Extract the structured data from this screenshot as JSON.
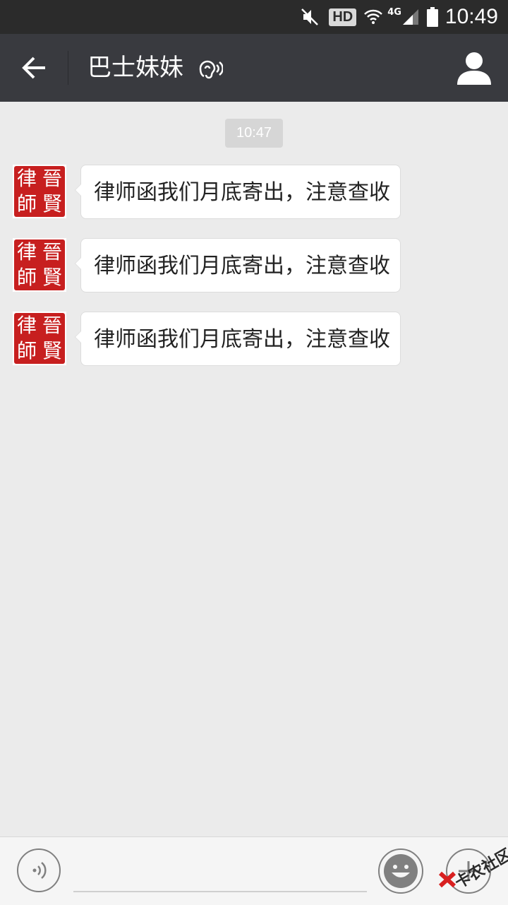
{
  "status_bar": {
    "hd_label": "HD",
    "network_label": "4G",
    "time": "10:49",
    "icons": [
      "mute-icon",
      "wifi-icon",
      "signal-icon",
      "battery-icon"
    ]
  },
  "header": {
    "title": "巴士妹妹",
    "back_icon": "arrow-left-icon",
    "ear_icon": "earpiece-mode-icon",
    "profile_icon": "person-icon"
  },
  "chat": {
    "timestamp": "10:47",
    "messages": [
      {
        "text": "律师函我们月底寄出，注意查收",
        "avatar": "lawyer-seal-avatar"
      },
      {
        "text": "律师函我们月底寄出，注意查收",
        "avatar": "lawyer-seal-avatar"
      },
      {
        "text": "律师函我们月底寄出，注意查收",
        "avatar": "lawyer-seal-avatar"
      }
    ],
    "seal_chars": [
      "律",
      "晉",
      "師",
      "賢"
    ]
  },
  "input_bar": {
    "value": "",
    "voice_icon": "voice-icon",
    "emoji_icon": "emoji-icon",
    "plus_icon": "plus-icon"
  },
  "watermark": {
    "text": "卡农社区"
  },
  "colors": {
    "status_bar_bg": "#2b2b2b",
    "header_bg": "#393a3f",
    "chat_bg": "#ebebeb",
    "seal_red": "#c71f1f"
  }
}
